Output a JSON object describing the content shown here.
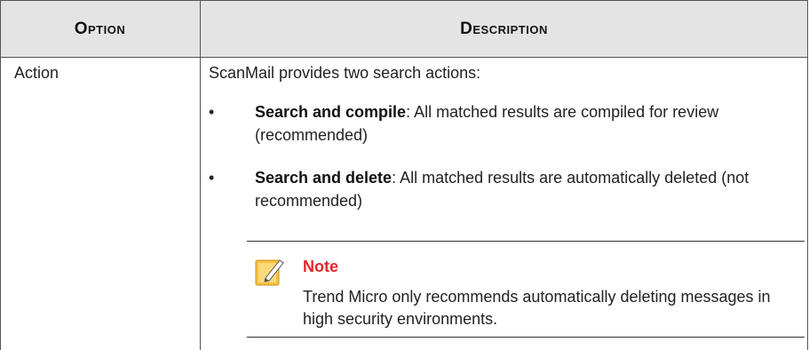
{
  "table": {
    "headers": {
      "option": "Option",
      "description": "Description"
    },
    "row": {
      "option": "Action",
      "intro": "ScanMail provides two search actions:",
      "bullets": [
        {
          "marker": "•",
          "term": "Search and compile",
          "text": ": All matched results are compiled for review (recommended)"
        },
        {
          "marker": "•",
          "term": "Search and delete",
          "text": ": All matched results are automatically deleted (not recommended)"
        }
      ],
      "note": {
        "icon": "note-pencil-icon",
        "title": "Note",
        "body": "Trend Micro only recommends automatically deleting messages in high security environments."
      }
    }
  },
  "colors": {
    "header_bg": "#e4e4e4",
    "note_title": "#e3262b",
    "note_icon": "#f6c342"
  }
}
